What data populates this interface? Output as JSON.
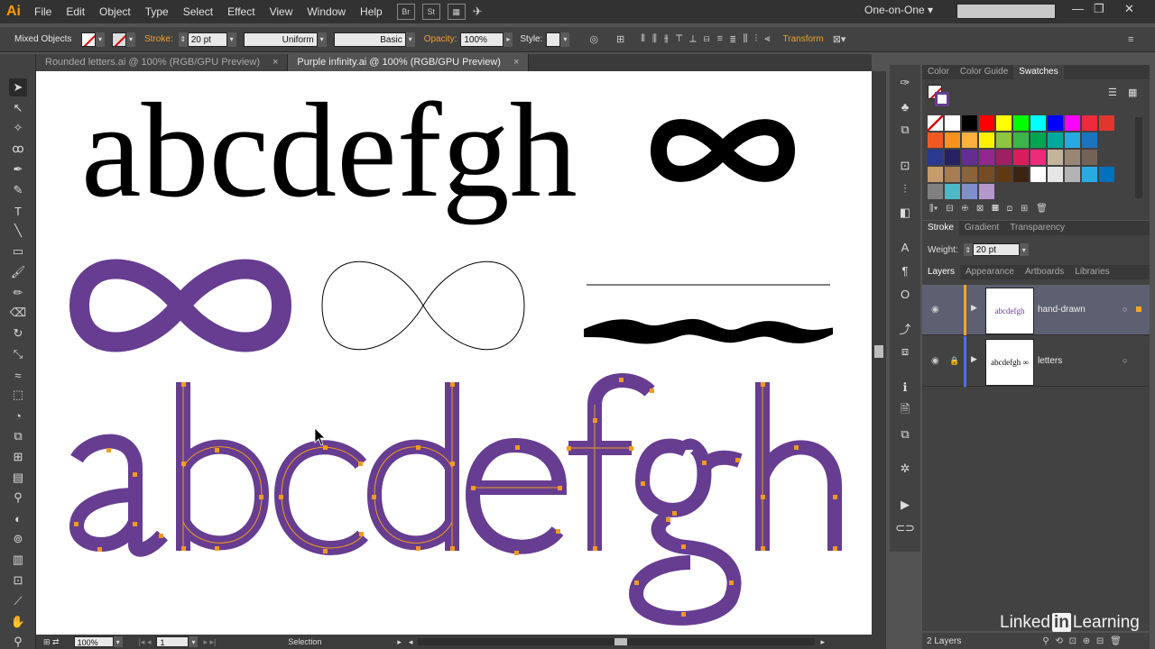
{
  "app": {
    "logo": "Ai",
    "menu": [
      "File",
      "Edit",
      "Object",
      "Type",
      "Select",
      "Effect",
      "View",
      "Window",
      "Help"
    ],
    "bridge_icon": "Br",
    "stock_icon": "St",
    "workspace": "One-on-One"
  },
  "control_bar": {
    "selection_type": "Mixed Objects",
    "stroke_label": "Stroke:",
    "stroke_weight": "20 pt",
    "profile": "Uniform",
    "brush": "Basic",
    "opacity_label": "Opacity:",
    "opacity": "100%",
    "style_label": "Style:",
    "transform_label": "Transform"
  },
  "tabs": [
    {
      "label": "Rounded letters.ai @ 100% (RGB/GPU Preview)",
      "active": false
    },
    {
      "label": "Purple infinity.ai @ 100% (RGB/GPU Preview)",
      "active": true
    }
  ],
  "artwork": {
    "serif_letters": "abcdefgh",
    "infinity_symbol": "∞",
    "colors": {
      "purple": "#663d91",
      "anchor": "#f29b1d",
      "black": "#000000"
    }
  },
  "status": {
    "zoom": "100%",
    "artboard": "1",
    "tool": "Selection"
  },
  "swatches_panel": {
    "tabs": [
      "Color",
      "Color Guide",
      "Swatches"
    ],
    "active_tab": "Swatches",
    "rows": [
      [
        "#ffffff",
        "#ffffff",
        "#000000",
        "#ff0000",
        "#ffff00",
        "#00ff00",
        "#00ffff",
        "#0000ff",
        "#ff00ff",
        "#ee2a3e",
        "#e0362e"
      ],
      [
        "#f05a22",
        "#f7931e",
        "#fbb040",
        "#fff200",
        "#8dc63f",
        "#39b54a",
        "#00a651",
        "#00a99d",
        "#27aae1",
        "#1c75bc"
      ],
      [
        "#2b3990",
        "#262262",
        "#662d91",
        "#92278f",
        "#9e1f63",
        "#da1c5c",
        "#ee2a7b",
        "#c2b59b",
        "#998675",
        "#736357"
      ],
      [
        "#c69c6d",
        "#a67c52",
        "#8c6239",
        "#754c24",
        "#603913",
        "#3c2415",
        "#ffffff",
        "#e6e6e6",
        "#b3b3b3",
        "#29abe2",
        "#0071bc"
      ],
      [
        "#808080",
        "#4db8c8",
        "#7f8fc9",
        "#b399c9"
      ]
    ]
  },
  "stroke_panel": {
    "tabs": [
      "Stroke",
      "Gradient",
      "Transparency"
    ],
    "weight_label": "Weight:",
    "weight": "20 pt"
  },
  "layers_panel": {
    "tabs": [
      "Layers",
      "Appearance",
      "Artboards",
      "Libraries"
    ],
    "layers": [
      {
        "name": "hand-drawn",
        "thumb": "abcdefgh",
        "selected": true,
        "color": "#f5a623"
      },
      {
        "name": "letters",
        "thumb": "abcdefgh ∞",
        "selected": false,
        "color": "#4f6bed"
      }
    ],
    "count": "2 Layers"
  },
  "watermark": {
    "pre": "Linked",
    "in": "in",
    "post": "Learning"
  }
}
